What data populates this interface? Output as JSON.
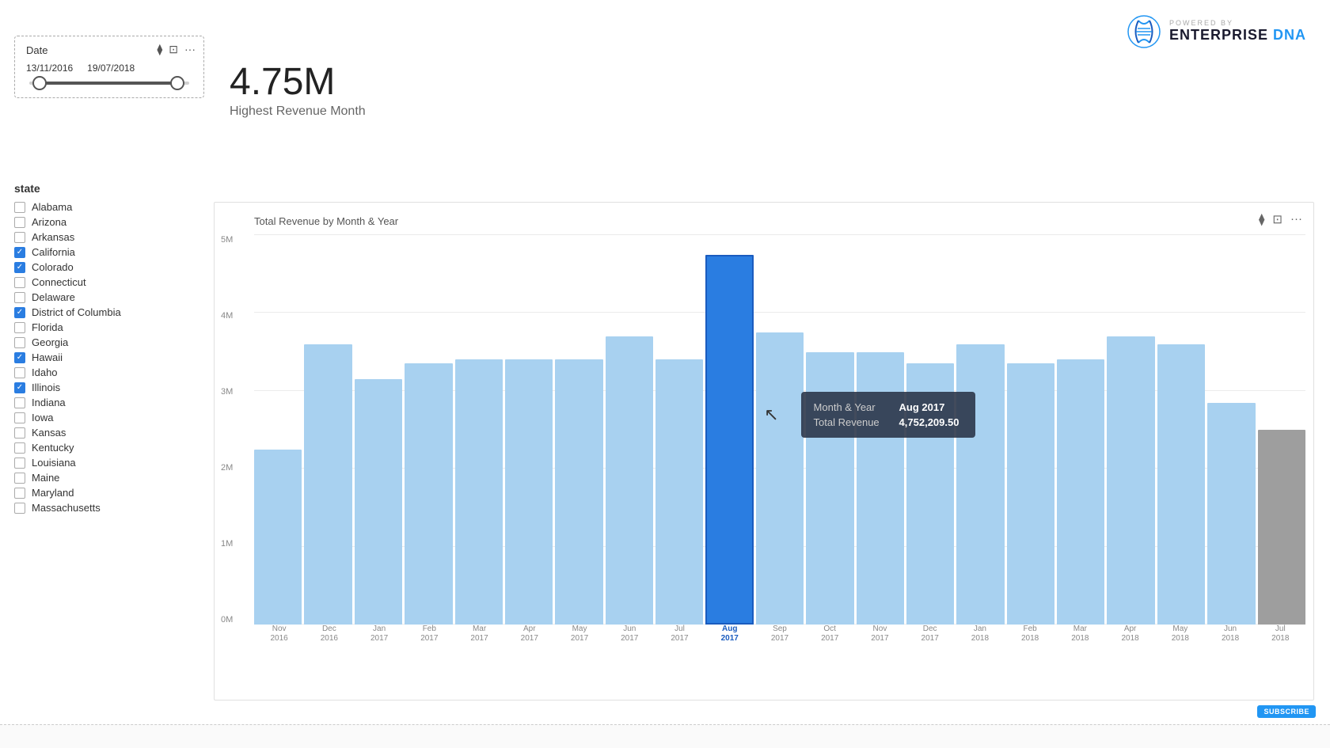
{
  "logo": {
    "text_main": "ENTERPRISE",
    "text_accent": "DNA",
    "aria": "Enterprise DNA logo"
  },
  "date_filter": {
    "label": "Date",
    "start": "13/11/2016",
    "end": "19/07/2018",
    "filter_icon": "⧫",
    "export_icon": "⊡",
    "more_icon": "···"
  },
  "kpi": {
    "value": "4.75M",
    "label": "Highest Revenue Month"
  },
  "state_filter": {
    "title": "state",
    "items": [
      {
        "label": "Alabama",
        "checked": false
      },
      {
        "label": "Arizona",
        "checked": false
      },
      {
        "label": "Arkansas",
        "checked": false
      },
      {
        "label": "California",
        "checked": true
      },
      {
        "label": "Colorado",
        "checked": true
      },
      {
        "label": "Connecticut",
        "checked": false
      },
      {
        "label": "Delaware",
        "checked": false
      },
      {
        "label": "District of Columbia",
        "checked": true
      },
      {
        "label": "Florida",
        "checked": false
      },
      {
        "label": "Georgia",
        "checked": false
      },
      {
        "label": "Hawaii",
        "checked": true
      },
      {
        "label": "Idaho",
        "checked": false
      },
      {
        "label": "Illinois",
        "checked": true
      },
      {
        "label": "Indiana",
        "checked": false
      },
      {
        "label": "Iowa",
        "checked": false
      },
      {
        "label": "Kansas",
        "checked": false
      },
      {
        "label": "Kentucky",
        "checked": false
      },
      {
        "label": "Louisiana",
        "checked": false
      },
      {
        "label": "Maine",
        "checked": false
      },
      {
        "label": "Maryland",
        "checked": false
      },
      {
        "label": "Massachusetts",
        "checked": false
      }
    ]
  },
  "chart": {
    "title": "Total Revenue by Month & Year",
    "y_labels": [
      "0M",
      "1M",
      "2M",
      "3M",
      "4M",
      "5M"
    ],
    "bars": [
      {
        "label": "Nov\n2016",
        "height_pct": 45,
        "highlighted": false,
        "gray": false
      },
      {
        "label": "Dec\n2016",
        "height_pct": 72,
        "highlighted": false,
        "gray": false
      },
      {
        "label": "Jan\n2017",
        "height_pct": 63,
        "highlighted": false,
        "gray": false
      },
      {
        "label": "Feb\n2017",
        "height_pct": 67,
        "highlighted": false,
        "gray": false
      },
      {
        "label": "Mar\n2017",
        "height_pct": 68,
        "highlighted": false,
        "gray": false
      },
      {
        "label": "Apr\n2017",
        "height_pct": 68,
        "highlighted": false,
        "gray": false
      },
      {
        "label": "May\n2017",
        "height_pct": 68,
        "highlighted": false,
        "gray": false
      },
      {
        "label": "Jun\n2017",
        "height_pct": 74,
        "highlighted": false,
        "gray": false
      },
      {
        "label": "Jul\n2017",
        "height_pct": 68,
        "highlighted": false,
        "gray": false
      },
      {
        "label": "Aug\n2017",
        "height_pct": 95,
        "highlighted": true,
        "gray": false
      },
      {
        "label": "Sep\n2017",
        "height_pct": 75,
        "highlighted": false,
        "gray": false
      },
      {
        "label": "Oct\n2017",
        "height_pct": 70,
        "highlighted": false,
        "gray": false
      },
      {
        "label": "Nov\n2017",
        "height_pct": 70,
        "highlighted": false,
        "gray": false
      },
      {
        "label": "Dec\n2017",
        "height_pct": 67,
        "highlighted": false,
        "gray": false
      },
      {
        "label": "Jan\n2018",
        "height_pct": 72,
        "highlighted": false,
        "gray": false
      },
      {
        "label": "Feb\n2018",
        "height_pct": 67,
        "highlighted": false,
        "gray": false
      },
      {
        "label": "Mar\n2018",
        "height_pct": 68,
        "highlighted": false,
        "gray": false
      },
      {
        "label": "Apr\n2018",
        "height_pct": 74,
        "highlighted": false,
        "gray": false
      },
      {
        "label": "May\n2018",
        "height_pct": 72,
        "highlighted": false,
        "gray": false
      },
      {
        "label": "Jun\n2018",
        "height_pct": 57,
        "highlighted": false,
        "gray": false
      },
      {
        "label": "Jul\n2018",
        "height_pct": 50,
        "highlighted": false,
        "gray": true
      }
    ],
    "tooltip": {
      "month_year_label": "Month & Year",
      "month_year_value": "Aug 2017",
      "revenue_label": "Total Revenue",
      "revenue_value": "4,752,209.50"
    }
  },
  "subscribe_label": "SUBSCRIBE"
}
